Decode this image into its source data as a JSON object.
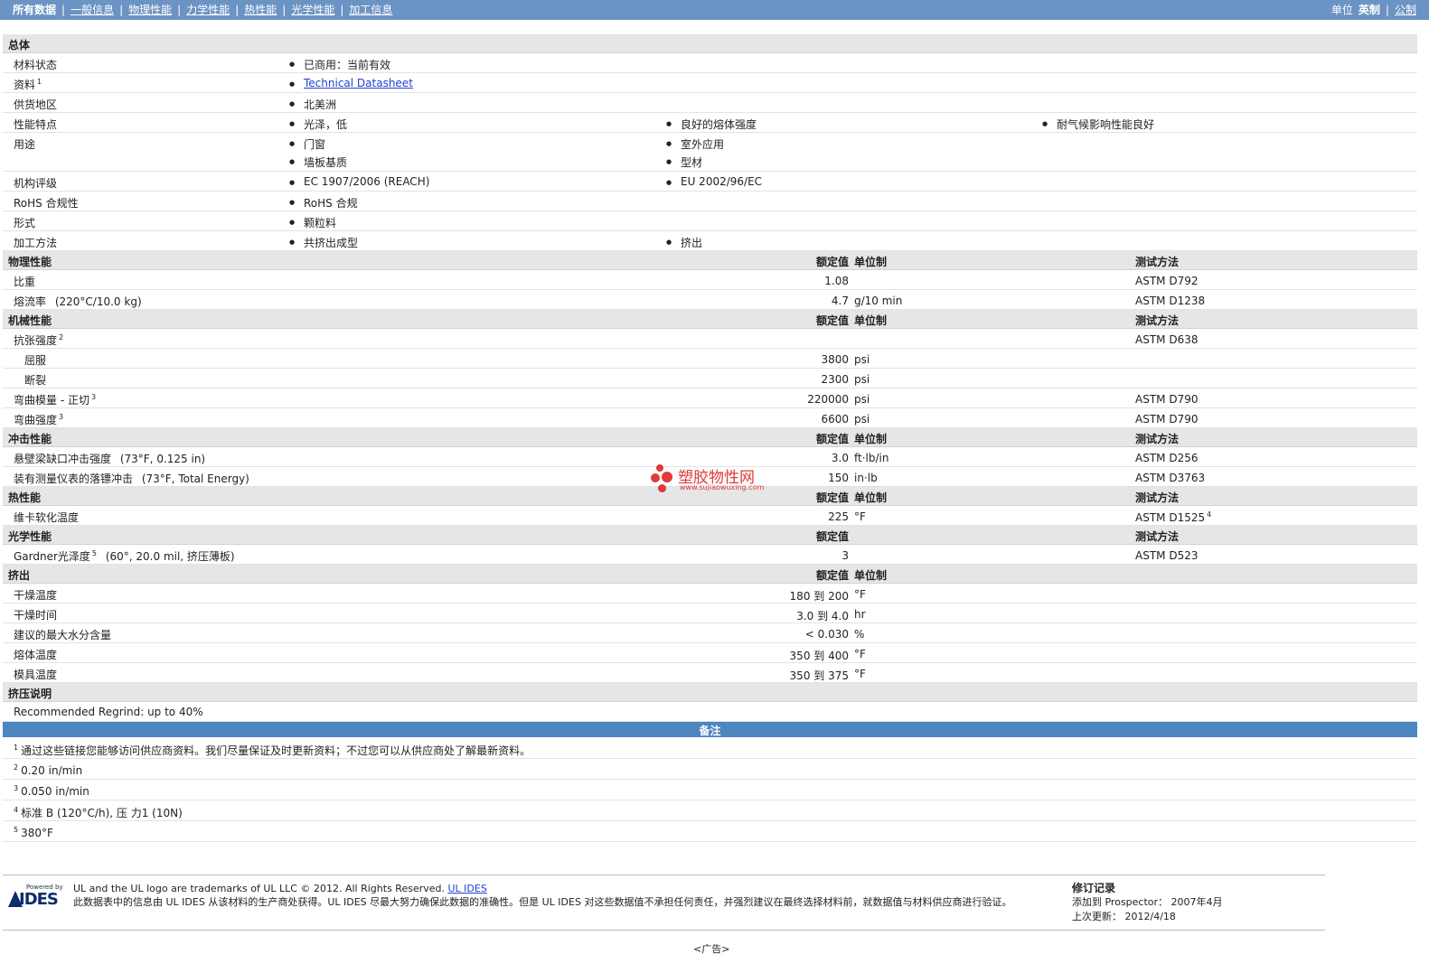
{
  "nav": {
    "tabs": [
      {
        "label": "所有数据",
        "active": true
      },
      {
        "label": "一般信息"
      },
      {
        "label": "物理性能"
      },
      {
        "label": "力学性能"
      },
      {
        "label": "热性能"
      },
      {
        "label": "光学性能"
      },
      {
        "label": "加工信息"
      }
    ],
    "units_label": "单位",
    "units": [
      {
        "label": "英制",
        "active": true
      },
      {
        "label": "公制"
      }
    ]
  },
  "general": {
    "title": "总体",
    "rows": [
      {
        "label": "材料状态",
        "values": [
          "已商用：当前有效"
        ]
      },
      {
        "label": "资料",
        "sup": "1",
        "link": "Technical Datasheet"
      },
      {
        "label": "供货地区",
        "values": [
          "北美洲"
        ]
      },
      {
        "label": "性能特点",
        "values": [
          "光泽，低",
          "良好的熔体强度",
          "耐气候影响性能良好"
        ]
      },
      {
        "label": "用途",
        "values": [
          "门窗",
          "室外应用",
          "墙板基质",
          "型材"
        ]
      },
      {
        "label": "机构评级",
        "values": [
          "EC 1907/2006 (REACH)",
          "EU 2002/96/EC"
        ]
      },
      {
        "label": "RoHS 合规性",
        "values": [
          "RoHS 合规"
        ]
      },
      {
        "label": "形式",
        "values": [
          "颗粒料"
        ]
      },
      {
        "label": "加工方法",
        "values": [
          "共挤出成型",
          "挤出"
        ]
      }
    ]
  },
  "headers": {
    "nominal": "额定值",
    "unit": "单位制",
    "method": "测试方法"
  },
  "physical": {
    "title": "物理性能",
    "rows": [
      {
        "label": "比重",
        "value": "1.08",
        "unit": "",
        "method": "ASTM D792"
      },
      {
        "label": "熔流率",
        "cond": "(220°C/10.0 kg)",
        "value": "4.7",
        "unit": "g/10 min",
        "method": "ASTM D1238"
      }
    ]
  },
  "mechanical": {
    "title": "机械性能",
    "rows": [
      {
        "label": "抗张强度",
        "sup": "2",
        "value": "",
        "unit": "",
        "method": "ASTM D638"
      },
      {
        "label": "屈服",
        "indent": true,
        "value": "3800",
        "unit": "psi",
        "method": ""
      },
      {
        "label": "断裂",
        "indent": true,
        "value": "2300",
        "unit": "psi",
        "method": ""
      },
      {
        "label": "弯曲模量 - 正切",
        "sup": "3",
        "value": "220000",
        "unit": "psi",
        "method": "ASTM D790"
      },
      {
        "label": "弯曲强度",
        "sup": "3",
        "value": "6600",
        "unit": "psi",
        "method": "ASTM D790"
      }
    ]
  },
  "impact": {
    "title": "冲击性能",
    "rows": [
      {
        "label": "悬壁梁缺口冲击强度",
        "cond": "(73°F, 0.125 in)",
        "value": "3.0",
        "unit": "ft·lb/in",
        "method": "ASTM D256"
      },
      {
        "label": "装有测量仪表的落镖冲击",
        "cond": "(73°F, Total Energy)",
        "value": "150",
        "unit": "in·lb",
        "method": "ASTM D3763"
      }
    ]
  },
  "thermal": {
    "title": "热性能",
    "rows": [
      {
        "label": "维卡软化温度",
        "value": "225",
        "unit": "°F",
        "method": "ASTM D1525",
        "method_sup": "4"
      }
    ]
  },
  "optical": {
    "title": "光学性能",
    "rows": [
      {
        "label": "Gardner光泽度",
        "sup": "5",
        "cond": "(60°, 20.0 mil, 挤压薄板)",
        "value": "3",
        "unit": "",
        "method": "ASTM D523"
      }
    ]
  },
  "extrusion": {
    "title": "挤出",
    "rows": [
      {
        "label": "干燥温度",
        "value": "180 到  200",
        "unit": "°F"
      },
      {
        "label": "干燥时间",
        "value": "3.0 到  4.0",
        "unit": "hr"
      },
      {
        "label": "建议的最大水分含量",
        "value": "< 0.030",
        "unit": "%"
      },
      {
        "label": "熔体温度",
        "value": "350 到  400",
        "unit": "°F"
      },
      {
        "label": "模具温度",
        "value": "350 到  375",
        "unit": "°F"
      }
    ]
  },
  "extrusion_notes": {
    "title": "挤压说明",
    "text": "Recommended Regrind: up to 40%"
  },
  "notes": {
    "title": "备注",
    "items": [
      {
        "n": "1",
        "text": "通过这些链接您能够访问供应商资料。我们尽量保证及时更新资料；不过您可以从供应商处了解最新资料。"
      },
      {
        "n": "2",
        "text": "0.20 in/min"
      },
      {
        "n": "3",
        "text": "0.050 in/min"
      },
      {
        "n": "4",
        "text": "标准 B (120°C/h), 压 力1 (10N)"
      },
      {
        "n": "5",
        "text": "380°F"
      }
    ]
  },
  "footer": {
    "powered_by": "Powered by",
    "logo_text": "IDES",
    "trademark": "UL and the UL logo are trademarks of UL LLC © 2012. All Rights Reserved.",
    "trademark_link": "UL IDES",
    "disclaimer": "此数据表中的信息由 UL IDES 从该材料的生产商处获得。UL IDES 尽最大努力确保此数据的准确性。但是 UL IDES 对这些数据值不承担任何责任，并强烈建议在最终选择材料前，就数据值与材料供应商进行验证。",
    "revision_title": "修订记录",
    "added_label": "添加到 Prospector：",
    "added_value": "2007年4月",
    "updated_label": "上次更新：",
    "updated_value": "2012/4/18",
    "ad": "<广告>"
  },
  "watermark": {
    "text": "塑胶物性网",
    "url": "www.sujiaowuxing.com"
  }
}
